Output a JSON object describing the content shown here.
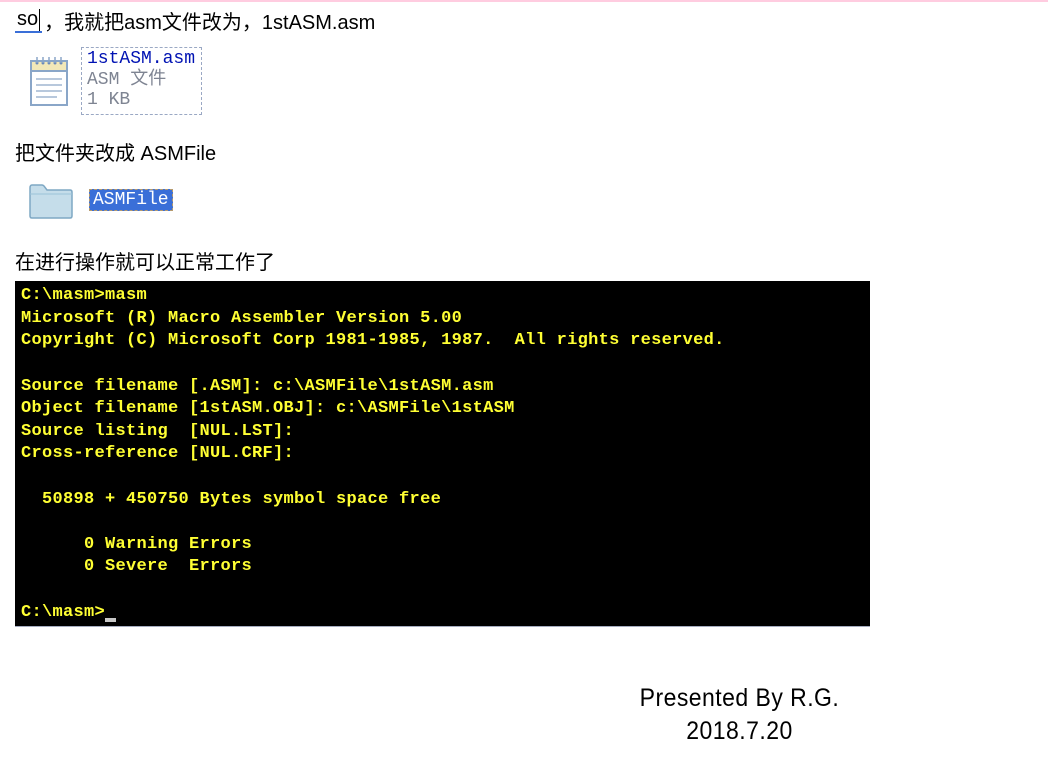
{
  "line1": {
    "prefix": "so",
    "rest": "，我就把asm文件改为，1stASM.asm"
  },
  "asm_file": {
    "name": "1stASM.asm",
    "type": "ASM 文件",
    "size": "1 KB"
  },
  "line2": "把文件夹改成 ASMFile",
  "folder": {
    "label": "ASMFile"
  },
  "line3": "在进行操作就可以正常工作了",
  "terminal": {
    "l0": "C:\\masm>masm",
    "l1": "Microsoft (R) Macro Assembler Version 5.00",
    "l2": "Copyright (C) Microsoft Corp 1981-1985, 1987.  All rights reserved.",
    "l3": "",
    "l4": "Source filename [.ASM]: c:\\ASMFile\\1stASM.asm",
    "l5": "Object filename [1stASM.OBJ]: c:\\ASMFile\\1stASM",
    "l6": "Source listing  [NUL.LST]:",
    "l7": "Cross-reference [NUL.CRF]:",
    "l8": "",
    "l9": "  50898 + 450750 Bytes symbol space free",
    "l10": "",
    "l11": "      0 Warning Errors",
    "l12": "      0 Severe  Errors",
    "l13": "",
    "l14": "C:\\masm>"
  },
  "footer": {
    "presented": "Presented By R.G.",
    "date": "2018.7.20"
  }
}
